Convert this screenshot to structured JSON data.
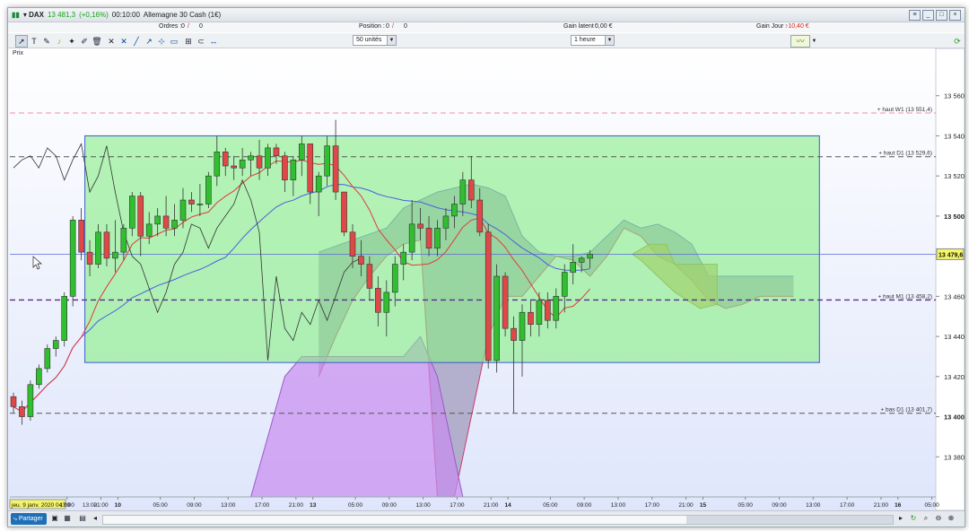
{
  "window": {
    "instrument": "DAX",
    "last": "13 481,3",
    "change": "(+0,16%)",
    "clock": "00:10:00",
    "name": "Allemagne 30 Cash (1€)"
  },
  "infobar": {
    "orders_label": "Ordres :",
    "orders_value": "0",
    "orders_sep": "/",
    "orders_value2": "0",
    "position_label": "Position :",
    "position_value": "0",
    "position_sep": "/",
    "position_value2": "0",
    "latent_label": "Gain latent :",
    "latent_value": "0,00 €",
    "day_label": "Gain Jour :",
    "day_value": "-10,40 €"
  },
  "toolbar": {
    "units_select": "50 unités",
    "period_select": "1 heure",
    "icons": [
      "cursor-icon",
      "text-tool-icon",
      "pencil-icon",
      "bell-icon",
      "wand-icon",
      "pen-icon",
      "trash-icon",
      "line-icon",
      "cross-icon",
      "slope-icon",
      "fork-icon",
      "rectangle-icon",
      "lasso-icon",
      "ruler-icon"
    ]
  },
  "panel": {
    "price_label": "Prix"
  },
  "levels": [
    {
      "label": "+ haut W1 (13 551,4)",
      "value": 13551.4,
      "color": "#f08aa8"
    },
    {
      "label": "+ haut D1 (13 529,6)",
      "value": 13529.6,
      "color": "#555555"
    },
    {
      "label": "+ haut M1 (13 458,2)",
      "value": 13458.2,
      "color": "#5a2a8a"
    },
    {
      "label": "+ bas D1 (13 401,7)",
      "value": 13401.7,
      "color": "#555555"
    }
  ],
  "chart_data": {
    "type": "candlestick",
    "y_ticks": [
      "13 560",
      "13 540",
      "13 520",
      "13 500",
      "13 480",
      "13 460",
      "13 440",
      "13 420",
      "13 400",
      "13 380"
    ],
    "y_bold": [
      "13 500",
      "13 400"
    ],
    "ylim": [
      13360,
      13580
    ],
    "price_badge": "13 479,6",
    "x_ticks": [
      {
        "label": "17:00",
        "i": 6
      },
      {
        "label": "21:00",
        "i": 10
      },
      {
        "label": "10",
        "i": 12,
        "bold": true
      },
      {
        "label": "05:00",
        "i": 17
      },
      {
        "label": "09:00",
        "i": 21
      },
      {
        "label": "13:00",
        "i": 25
      },
      {
        "label": "17:00",
        "i": 29
      },
      {
        "label": "21:00",
        "i": 33
      },
      {
        "label": "13",
        "i": 35,
        "bold": true
      },
      {
        "label": "05:00",
        "i": 40
      },
      {
        "label": "09:00",
        "i": 44
      },
      {
        "label": "13:00",
        "i": 48
      },
      {
        "label": "17:00",
        "i": 52
      },
      {
        "label": "21:00",
        "i": 56
      },
      {
        "label": "14",
        "i": 58,
        "bold": true
      },
      {
        "label": "05:00",
        "i": 63
      },
      {
        "label": "09:00",
        "i": 67
      },
      {
        "label": "13:00",
        "i": 71
      },
      {
        "label": "17:00",
        "i": 75
      },
      {
        "label": "21:00",
        "i": 79
      },
      {
        "label": "15",
        "i": 81,
        "bold": true
      },
      {
        "label": "05:00",
        "i": 86
      },
      {
        "label": "09:00",
        "i": 90
      },
      {
        "label": "13:00",
        "i": 94
      },
      {
        "label": "17:00",
        "i": 98
      },
      {
        "label": "21:00",
        "i": 102
      },
      {
        "label": "16",
        "i": 104,
        "bold": true
      },
      {
        "label": "05:00",
        "i": 108
      }
    ],
    "x_first": "jeu. 9 janv. 2020 04:00",
    "first_extra": "13:00",
    "candles": [
      [
        13410,
        13412,
        13402,
        13405
      ],
      [
        13405,
        13408,
        13396,
        13400
      ],
      [
        13400,
        13418,
        13398,
        13416
      ],
      [
        13416,
        13426,
        13414,
        13424
      ],
      [
        13424,
        13436,
        13422,
        13434
      ],
      [
        13434,
        13440,
        13430,
        13438
      ],
      [
        13438,
        13462,
        13435,
        13460
      ],
      [
        13460,
        13500,
        13455,
        13498
      ],
      [
        13498,
        13504,
        13478,
        13482
      ],
      [
        13482,
        13488,
        13470,
        13476
      ],
      [
        13476,
        13496,
        13474,
        13492
      ],
      [
        13492,
        13496,
        13475,
        13479
      ],
      [
        13479,
        13498,
        13472,
        13482
      ],
      [
        13482,
        13496,
        13478,
        13494
      ],
      [
        13494,
        13512,
        13490,
        13510
      ],
      [
        13510,
        13512,
        13480,
        13490
      ],
      [
        13490,
        13502,
        13486,
        13496
      ],
      [
        13496,
        13504,
        13490,
        13500
      ],
      [
        13500,
        13510,
        13490,
        13494
      ],
      [
        13494,
        13506,
        13490,
        13498
      ],
      [
        13498,
        13514,
        13494,
        13508
      ],
      [
        13508,
        13512,
        13502,
        13506
      ],
      [
        13506,
        13516,
        13500,
        13506
      ],
      [
        13506,
        13522,
        13504,
        13520
      ],
      [
        13520,
        13540,
        13515,
        13532
      ],
      [
        13532,
        13534,
        13520,
        13525
      ],
      [
        13525,
        13530,
        13518,
        13524
      ],
      [
        13524,
        13534,
        13520,
        13528
      ],
      [
        13528,
        13532,
        13520,
        13530
      ],
      [
        13530,
        13538,
        13518,
        13524
      ],
      [
        13524,
        13536,
        13520,
        13534
      ],
      [
        13534,
        13536,
        13526,
        13530
      ],
      [
        13530,
        13532,
        13512,
        13518
      ],
      [
        13518,
        13530,
        13510,
        13528
      ],
      [
        13528,
        13540,
        13520,
        13536
      ],
      [
        13536,
        13536,
        13506,
        13512
      ],
      [
        13512,
        13522,
        13500,
        13520
      ],
      [
        13520,
        13540,
        13515,
        13535
      ],
      [
        13535,
        13548,
        13508,
        13512
      ],
      [
        13512,
        13512,
        13490,
        13492
      ],
      [
        13492,
        13496,
        13474,
        13480
      ],
      [
        13480,
        13488,
        13470,
        13476
      ],
      [
        13476,
        13480,
        13458,
        13464
      ],
      [
        13464,
        13470,
        13445,
        13452
      ],
      [
        13452,
        13468,
        13440,
        13462
      ],
      [
        13462,
        13480,
        13455,
        13476
      ],
      [
        13476,
        13486,
        13468,
        13482
      ],
      [
        13482,
        13508,
        13478,
        13496
      ],
      [
        13496,
        13504,
        13488,
        13494
      ],
      [
        13494,
        13500,
        13480,
        13484
      ],
      [
        13484,
        13498,
        13480,
        13494
      ],
      [
        13494,
        13504,
        13488,
        13500
      ],
      [
        13500,
        13510,
        13494,
        13506
      ],
      [
        13506,
        13522,
        13500,
        13518
      ],
      [
        13518,
        13530,
        13504,
        13508
      ],
      [
        13508,
        13514,
        13490,
        13492
      ],
      [
        13492,
        13496,
        13424,
        13428
      ],
      [
        13428,
        13476,
        13422,
        13470
      ],
      [
        13470,
        13472,
        13440,
        13444
      ],
      [
        13444,
        13450,
        13402,
        13438
      ],
      [
        13438,
        13456,
        13420,
        13452
      ],
      [
        13452,
        13458,
        13440,
        13446
      ],
      [
        13446,
        13462,
        13440,
        13458
      ],
      [
        13458,
        13462,
        13444,
        13448
      ],
      [
        13448,
        13464,
        13444,
        13460
      ],
      [
        13460,
        13476,
        13452,
        13472
      ],
      [
        13472,
        13486,
        13466,
        13477
      ],
      [
        13477,
        13480,
        13472,
        13479
      ],
      [
        13479,
        13483,
        13474,
        13481
      ]
    ],
    "cloud_a": [
      [
        36,
        13482
      ],
      [
        40,
        13488
      ],
      [
        44,
        13494
      ],
      [
        46,
        13504
      ],
      [
        48,
        13508
      ],
      [
        50,
        13512
      ],
      [
        52,
        13514
      ],
      [
        54,
        13516
      ],
      [
        56,
        13514
      ],
      [
        58,
        13510
      ],
      [
        60,
        13490
      ],
      [
        62,
        13482
      ],
      [
        64,
        13480
      ],
      [
        66,
        13480
      ],
      [
        68,
        13482
      ],
      [
        70,
        13490
      ],
      [
        72,
        13498
      ],
      [
        74,
        13494
      ],
      [
        76,
        13496
      ],
      [
        78,
        13492
      ],
      [
        80,
        13486
      ],
      [
        82,
        13470
      ],
      [
        84,
        13470
      ],
      [
        86,
        13470
      ],
      [
        88,
        13470
      ],
      [
        90,
        13470
      ],
      [
        92,
        13470
      ]
    ],
    "cloud_b": [
      [
        36,
        13420
      ],
      [
        38,
        13440
      ],
      [
        40,
        13458
      ],
      [
        42,
        13470
      ],
      [
        44,
        13480
      ],
      [
        46,
        13486
      ],
      [
        48,
        13488
      ],
      [
        50,
        13360
      ],
      [
        52,
        13360
      ],
      [
        54,
        13400
      ],
      [
        56,
        13440
      ],
      [
        58,
        13460
      ],
      [
        60,
        13460
      ],
      [
        62,
        13470
      ],
      [
        64,
        13480
      ],
      [
        66,
        13478
      ],
      [
        68,
        13470
      ],
      [
        70,
        13480
      ],
      [
        72,
        13494
      ],
      [
        74,
        13490
      ],
      [
        76,
        13480
      ],
      [
        78,
        13476
      ],
      [
        80,
        13468
      ],
      [
        82,
        13458
      ],
      [
        84,
        13454
      ],
      [
        86,
        13456
      ],
      [
        88,
        13460
      ],
      [
        90,
        13460
      ],
      [
        92,
        13460
      ]
    ],
    "green_zone": {
      "x_from": 8,
      "x_to": 94,
      "top": 13540,
      "bottom": 13427
    }
  }
}
